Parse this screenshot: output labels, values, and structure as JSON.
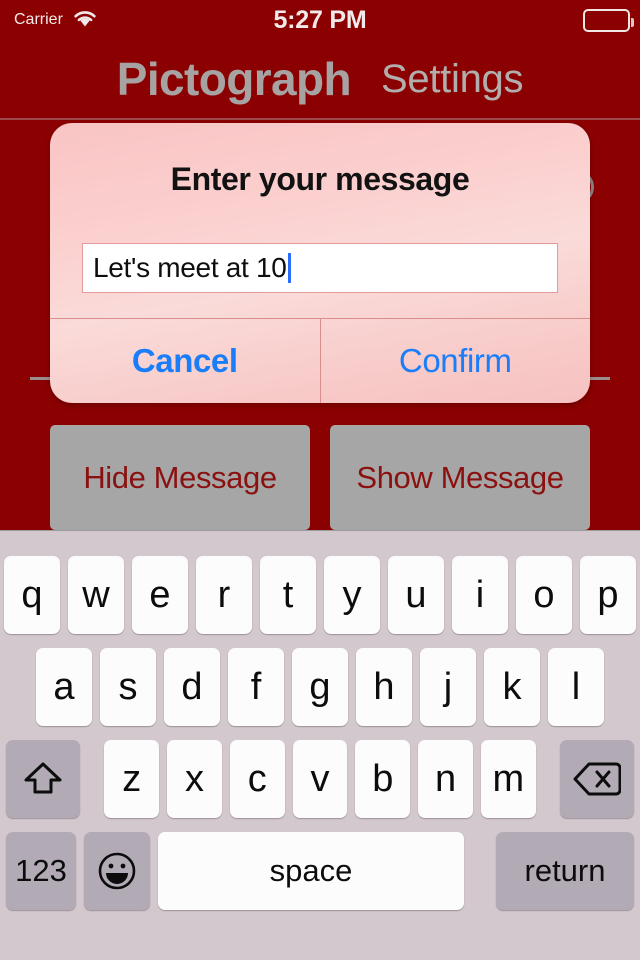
{
  "status_bar": {
    "carrier": "Carrier",
    "wifi_icon": "wifi-icon",
    "time": "5:27 PM",
    "battery_icon": "battery-icon"
  },
  "nav_bar": {
    "title": "Pictograph",
    "settings_label": "Settings"
  },
  "background": {
    "hide_message_label": "Hide Message",
    "show_message_label": "Show Message"
  },
  "alert": {
    "title": "Enter your message",
    "input_value": "Let's meet at 10",
    "input_placeholder": "",
    "cancel_label": "Cancel",
    "confirm_label": "Confirm"
  },
  "keyboard": {
    "row1": [
      "q",
      "w",
      "e",
      "r",
      "t",
      "y",
      "u",
      "i",
      "o",
      "p"
    ],
    "row2": [
      "a",
      "s",
      "d",
      "f",
      "g",
      "h",
      "j",
      "k",
      "l"
    ],
    "row3": [
      "z",
      "x",
      "c",
      "v",
      "b",
      "n",
      "m"
    ],
    "shift_icon": "shift-icon",
    "backspace_icon": "backspace-icon",
    "numbers_label": "123",
    "emoji_icon": "emoji-icon",
    "space_label": "space",
    "return_label": "return"
  },
  "colors": {
    "app_background": "#8B0000",
    "nav_title": "#a8a3a3",
    "alert_background": "#fbd0cf",
    "alert_button_text": "#1a7dfa",
    "action_button_bg": "#a6a6a6",
    "action_button_text": "#8B1111",
    "keyboard_bg": "#d3c8cd",
    "key_bg": "#fdfcfc",
    "key_dark_bg": "#b2abb6",
    "caret": "#2b6dfa"
  }
}
